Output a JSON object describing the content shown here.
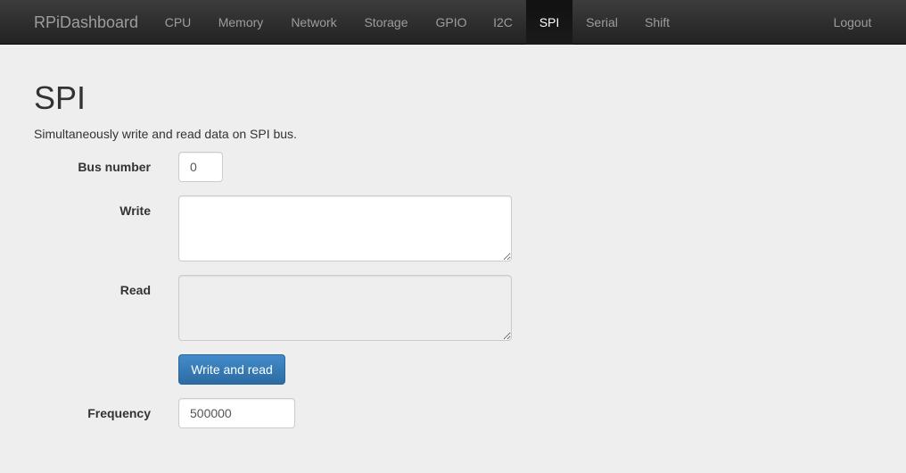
{
  "nav": {
    "brand": "RPiDashboard",
    "items": [
      {
        "label": "CPU"
      },
      {
        "label": "Memory"
      },
      {
        "label": "Network"
      },
      {
        "label": "Storage"
      },
      {
        "label": "GPIO"
      },
      {
        "label": "I2C"
      },
      {
        "label": "SPI",
        "active": true
      },
      {
        "label": "Serial"
      },
      {
        "label": "Shift"
      }
    ],
    "logout": "Logout"
  },
  "page": {
    "title": "SPI",
    "description": "Simultaneously write and read data on SPI bus."
  },
  "form": {
    "bus_label": "Bus number",
    "bus_value": "0",
    "write_label": "Write",
    "write_value": "",
    "read_label": "Read",
    "read_value": "",
    "submit_label": "Write and read",
    "frequency_label": "Frequency",
    "frequency_value": "500000"
  },
  "colors": {
    "navbar": "#222222",
    "active_nav_text": "#ffffff",
    "nav_text": "#9d9d9d",
    "primary": "#428bca",
    "background": "#eeeeee"
  }
}
